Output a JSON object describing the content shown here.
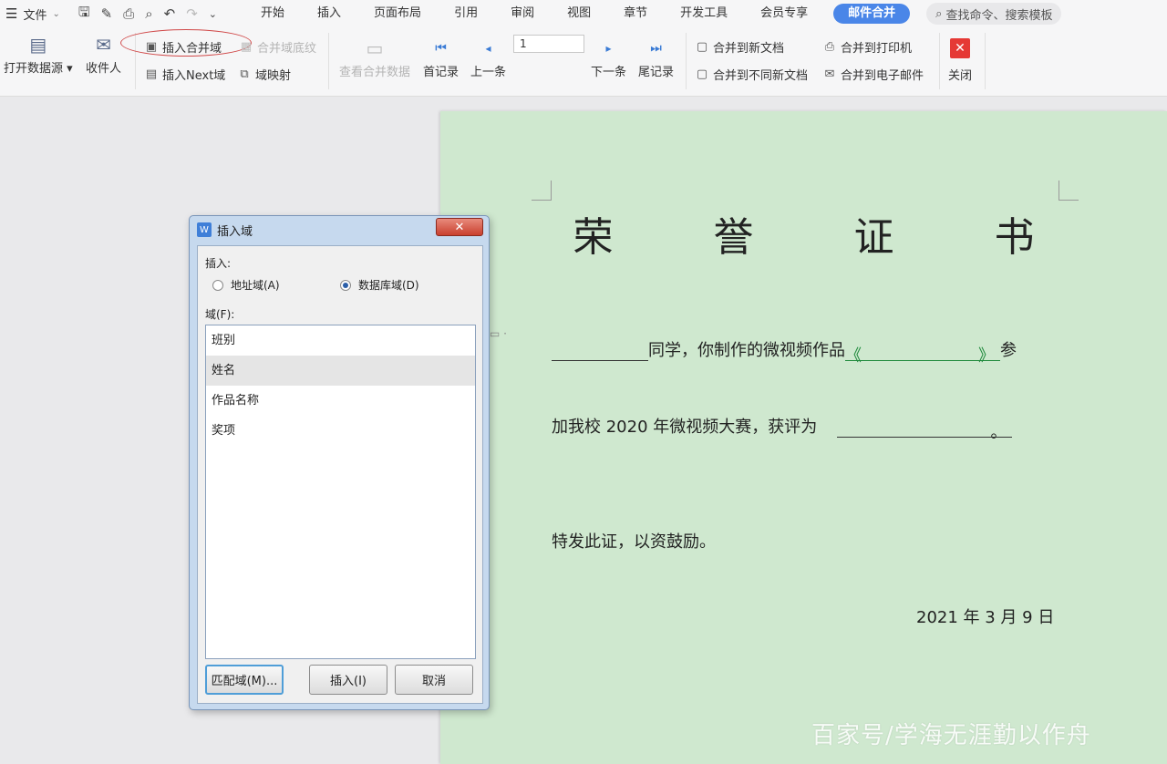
{
  "menubar": {
    "file_label": "文件",
    "tabs": [
      "开始",
      "插入",
      "页面布局",
      "引用",
      "审阅",
      "视图",
      "章节",
      "开发工具",
      "会员专享"
    ],
    "active_tab": "邮件合并",
    "search_placeholder": "查找命令、搜索模板"
  },
  "ribbon": {
    "open_data_source": "打开数据源",
    "recipients": "收件人",
    "insert_merge_field": "插入合并域",
    "merge_field_shading": "合并域底纹",
    "insert_next_field": "插入Next域",
    "field_codes": "域映射",
    "view_merged_data": "查看合并数据",
    "first_record": "首记录",
    "prev_record": "上一条",
    "record_number": "1",
    "next_record": "下一条",
    "last_record": "尾记录",
    "merge_to_new_doc": "合并到新文档",
    "merge_to_separate_docs": "合并到不同新文档",
    "merge_to_printer": "合并到打印机",
    "merge_to_email": "合并到电子邮件",
    "close": "关闭"
  },
  "document": {
    "title": "荣 誉 证 书",
    "line1_mid": "同学，你制作的微视频作品",
    "line1_open_quote": "《",
    "line1_close_quote": "》",
    "line1_end": "参",
    "line2_start": "加我校 2020 年微视频大赛，获评为",
    "line2_end": "。",
    "line3": "特发此证，以资鼓励。",
    "date": "2021 年 3 月 9 日"
  },
  "dialog": {
    "title": "插入域",
    "close_glyph": "✕",
    "insert_label": "插入:",
    "radio_address": "地址域(A)",
    "radio_database": "数据库域(D)",
    "fields_label": "域(F):",
    "fields": [
      "班别",
      "姓名",
      "作品名称",
      "奖项"
    ],
    "selected_field": "姓名",
    "btn_match": "匹配域(M)...",
    "btn_insert": "插入(I)",
    "btn_cancel": "取消"
  },
  "watermark": "百家号/学海无涯勤以作舟",
  "colors": {
    "page_bg": "#cfe8cf",
    "active_tab": "#4a86e8",
    "close_red": "#e53935",
    "annotation_oval": "#d04848"
  }
}
